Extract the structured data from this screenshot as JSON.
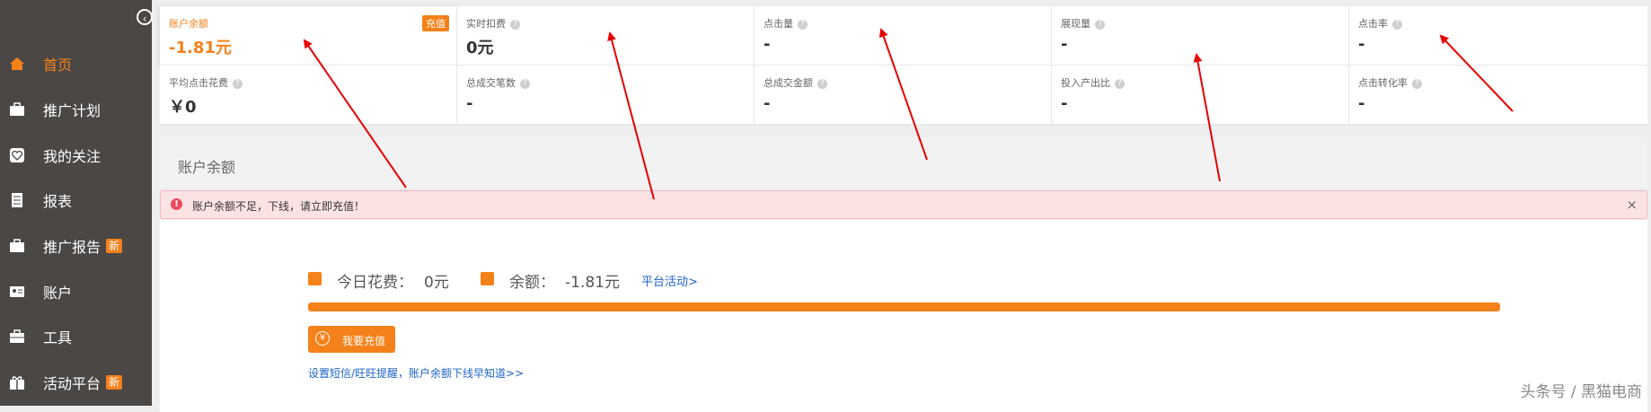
{
  "sidebar": {
    "items": [
      {
        "label": "首页",
        "icon": "home-icon",
        "active": true
      },
      {
        "label": "推广计划",
        "icon": "briefcase-icon"
      },
      {
        "label": "我的关注",
        "icon": "heart-icon"
      },
      {
        "label": "报表",
        "icon": "report-icon"
      },
      {
        "label": "推广报告",
        "icon": "briefcase-icon",
        "badge": "新"
      },
      {
        "label": "账户",
        "icon": "id-card-icon"
      },
      {
        "label": "工具",
        "icon": "toolbox-icon"
      },
      {
        "label": "活动平台",
        "icon": "gift-icon",
        "badge": "新"
      }
    ]
  },
  "metrics": [
    {
      "label": "账户余额",
      "value": "-1.81元",
      "tag": "充值"
    },
    {
      "label": "实时扣费",
      "value": "0元"
    },
    {
      "label": "点击量",
      "value": "-"
    },
    {
      "label": "展现量",
      "value": "-"
    },
    {
      "label": "点击率",
      "value": "-"
    },
    {
      "label": "平均点击花费",
      "value": "￥0"
    },
    {
      "label": "总成交笔数",
      "value": "-"
    },
    {
      "label": "总成交金额",
      "value": "-"
    },
    {
      "label": "投入产出比",
      "value": "-"
    },
    {
      "label": "点击转化率",
      "value": "-"
    }
  ],
  "section": {
    "title": "账户余额"
  },
  "alert": {
    "message": "账户余额不足，下线，请立即充值！",
    "close": "×"
  },
  "balance": {
    "today_label": "今日花费：",
    "today_value": "0元",
    "balance_label": "余额：",
    "balance_value": "-1.81元",
    "activity_link": "平台活动>",
    "progress": 1.0,
    "recharge_button": "我要充值",
    "recharge_icon": "yen-icon",
    "sms_link": "设置短信/旺旺提醒，账户余额下线早知道>>"
  },
  "watermark": "头条号 / 黑猫电商",
  "colors": {
    "accent": "#f5811a",
    "sidebar": "#4a4745",
    "alert_bg": "#fbe3e4",
    "arrow": "#e60000"
  }
}
